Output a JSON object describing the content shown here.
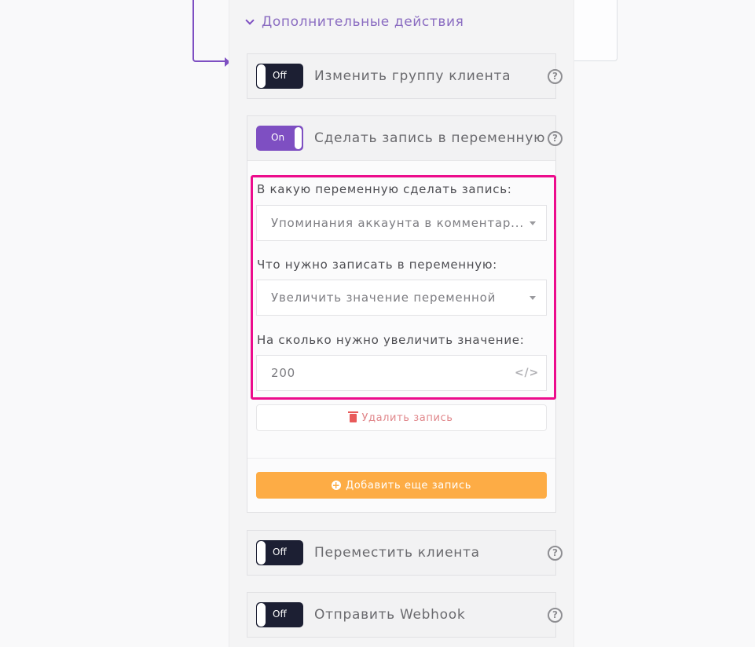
{
  "section": {
    "title": "Дополнительные действия"
  },
  "actions": [
    {
      "title": "Изменить группу клиента",
      "toggle_state": "Off"
    },
    {
      "title": "Сделать запись в переменную",
      "toggle_state": "On",
      "fields": {
        "variable_label": "В какую переменную сделать запись:",
        "variable_value": "Упоминания аккаунта в комментар...",
        "operation_label": "Что нужно записать в переменную:",
        "operation_value": "Увеличить значение переменной",
        "amount_label": "На сколько нужно увеличить значение:",
        "amount_value": "200"
      },
      "delete_label": "Удалить запись",
      "add_label": "Добавить еще запись"
    },
    {
      "title": "Переместить клиента",
      "toggle_state": "Off"
    },
    {
      "title": "Отправить Webhook",
      "toggle_state": "Off"
    }
  ],
  "icons": {
    "help": "?",
    "code": "</>",
    "plus": "+"
  },
  "colors": {
    "accent": "#7e4fc2",
    "toggle_off": "#1c1f33",
    "highlight": "#ec0c8c",
    "add_button": "#fdac45",
    "delete_text": "#e0868a"
  }
}
